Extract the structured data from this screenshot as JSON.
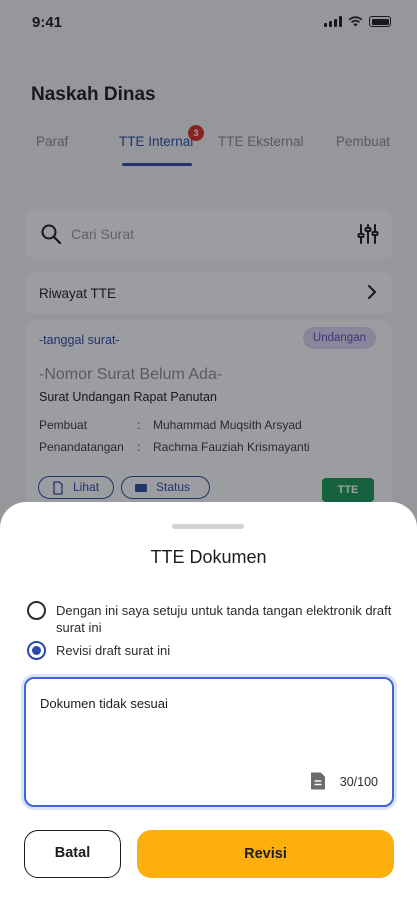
{
  "status_bar": {
    "time": "9:41"
  },
  "header": {
    "title": "Naskah Dinas"
  },
  "tabs": [
    {
      "label": "Paraf",
      "active": false
    },
    {
      "label": "TTE Internal",
      "active": true,
      "badge": "3"
    },
    {
      "label": "TTE Eksternal",
      "active": false
    },
    {
      "label": "Pembuat",
      "active": false
    }
  ],
  "search": {
    "placeholder": "Cari Surat"
  },
  "history": {
    "label": "Riwayat TTE"
  },
  "document": {
    "date": "-tanggal surat-",
    "category": "Undangan",
    "number": "-Nomor Surat Belum Ada-",
    "subject": "Surat Undangan Rapat Panutan",
    "meta": [
      {
        "key": "Pembuat",
        "sep": ":",
        "value": "Muhammad Muqsith Arsyad"
      },
      {
        "key": "Penandatangan",
        "sep": ":",
        "value": "Rachma Fauziah Krismayanti"
      }
    ],
    "view_label": "Lihat",
    "status_label": "Status",
    "tte_label": "TTE"
  },
  "sheet": {
    "title": "TTE Dokumen",
    "options": [
      {
        "label": "Dengan ini saya setuju untuk tanda tangan elektronik draft surat ini",
        "selected": false
      },
      {
        "label": "Revisi draft surat ini",
        "selected": true
      }
    ],
    "note_value": "Dokumen tidak sesuai",
    "char_count": "30/100",
    "cancel_label": "Batal",
    "submit_label": "Revisi"
  },
  "colors": {
    "primary": "#2b4aa8",
    "accent": "#fdb00d",
    "badge_red": "#d93025",
    "tte_green": "#1a9a57"
  }
}
